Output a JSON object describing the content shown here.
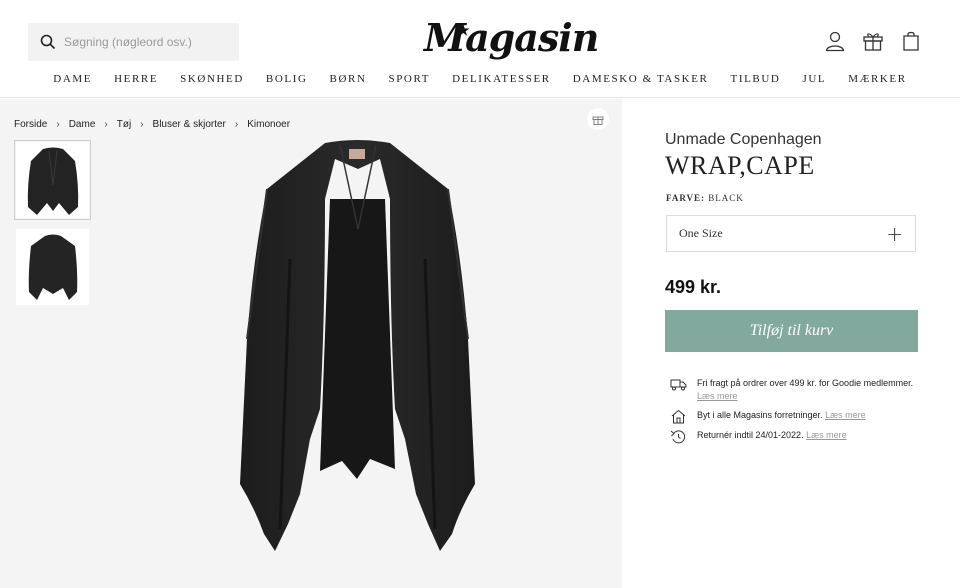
{
  "header": {
    "search_placeholder": "Søgning (nøgleord osv.)",
    "logo": "Magasin",
    "nav": [
      "DAME",
      "HERRE",
      "SKØNHED",
      "BOLIG",
      "BØRN",
      "SPORT",
      "DELIKATESSER",
      "DAMESKO & TASKER",
      "TILBUD",
      "JUL",
      "MÆRKER"
    ],
    "icons": [
      "user-icon",
      "gift-icon",
      "bag-icon"
    ]
  },
  "breadcrumb": [
    "Forside",
    "Dame",
    "Tøj",
    "Bluser & skjorter",
    "Kimonoer"
  ],
  "product": {
    "brand": "Unmade Copenhagen",
    "name": "WRAP,CAPE",
    "color_label": "FARVE:",
    "color_value": "BLACK",
    "size": "One Size",
    "price": "499 kr.",
    "add_to_cart": "Tilføj til kurv"
  },
  "info": [
    {
      "icon": "truck-icon",
      "text": "Fri fragt på ordrer over 499 kr. for Goodie medlemmer.",
      "link": "Læs mere"
    },
    {
      "icon": "store-icon",
      "text": "Byt i alle Magasins forretninger.",
      "link": "Læs mere"
    },
    {
      "icon": "return-icon",
      "text": "Returnér indtil 24/01-2022.",
      "link": "Læs mere"
    }
  ],
  "colors": {
    "accent": "#81a99e",
    "gallery_bg": "#f4f4f4",
    "garment": "#232323"
  }
}
